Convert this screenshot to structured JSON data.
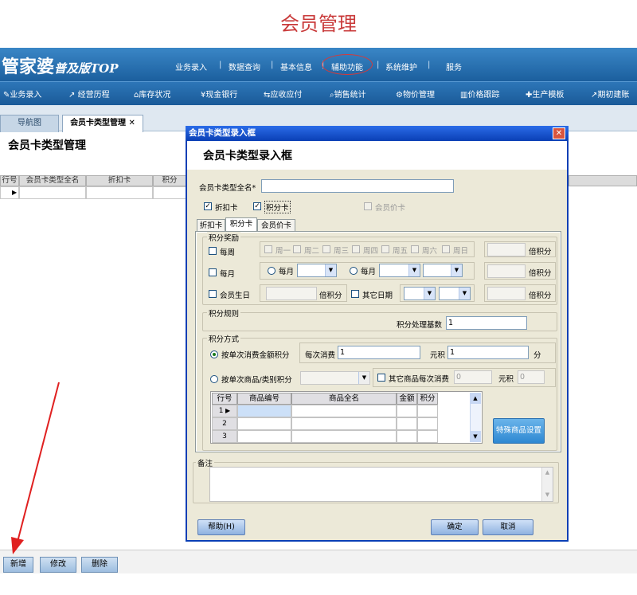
{
  "page_title": "会员管理",
  "app": {
    "logo_main": "管家婆",
    "logo_sub": "普及版TOP"
  },
  "top_menu": [
    "业务录入",
    "数据查询",
    "基本信息",
    "辅助功能",
    "系统维护",
    "服务"
  ],
  "toolbar": [
    "业务录入",
    "经营历程",
    "库存状况",
    "现金银行",
    "应收应付",
    "销售统计",
    "物价管理",
    "价格跟踪",
    "生产模板",
    "期初建账"
  ],
  "tabs": {
    "nav": "导航图",
    "mgr": "会员卡类型管理 ✕"
  },
  "mgr_title": "会员卡类型管理",
  "bg_table": {
    "headers": [
      "行号",
      "会员卡类型全名",
      "折扣卡",
      "积分"
    ]
  },
  "bottom_buttons": {
    "add": "新增",
    "edit": "修改",
    "delete": "删除"
  },
  "dialog": {
    "title": "会员卡类型录入框",
    "heading": "会员卡类型录入框",
    "name_label": "会员卡类型全名*",
    "name_value": "",
    "cb_discount": "折扣卡",
    "cb_points": "积分卡",
    "cb_price": "会员价卡",
    "tabs": [
      "折扣卡",
      "积分卡",
      "会员价卡"
    ],
    "reward_group": "积分奖励",
    "weekly": "每周",
    "weekdays": [
      "周一",
      "周二",
      "周三",
      "周四",
      "周五",
      "周六",
      "周日"
    ],
    "times_points": "倍积分",
    "monthly": "每月",
    "monthly_opt": "每月",
    "birthday": "会员生日",
    "other_date": "其它日期",
    "rule_group": "积分规则",
    "base_label": "积分处理基数",
    "base_value": "1",
    "method_group": "积分方式",
    "by_amount": "按单次消费金额积分",
    "per_spend": "每次消费",
    "per_spend_value": "1",
    "yuan_points": "元积",
    "yuan_points_value": "1",
    "fen": "分",
    "by_product": "按单次商品/类别积分",
    "other_product": "其它商品每次消费",
    "other_value": "0",
    "other_yuan_points": "元积",
    "other_points_value": "0",
    "grid_headers": [
      "行号",
      "商品编号",
      "商品全名",
      "金额",
      "积分"
    ],
    "grid_rows": [
      "1",
      "2",
      "3"
    ],
    "special_btn": "特殊商品设置",
    "note_label": "备注",
    "help_btn": "帮助(H)",
    "ok_btn": "确定",
    "cancel_btn": "取消"
  }
}
